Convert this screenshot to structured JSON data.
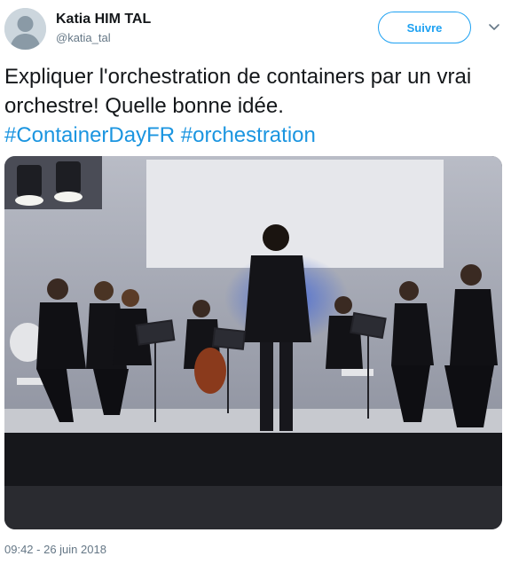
{
  "user": {
    "name": "Katia HIM TAL",
    "handle": "@katia_tal",
    "avatar_icon": "default-avatar-icon"
  },
  "follow_button": {
    "label": "Suivre"
  },
  "menu_icon": "chevron-down-icon",
  "tweet": {
    "text_line": "Expliquer l'orchestration de containers par un vrai orchestre! Quelle bonne idée.",
    "hashtags": [
      "#ContainerDayFR",
      "#orchestration"
    ]
  },
  "media": {
    "type": "photo"
  },
  "timestamp": "09:42 - 26 juin 2018",
  "colors": {
    "accent": "#1da1f2",
    "hashtag": "#1b95e0",
    "secondary_text": "#657786",
    "primary_text": "#14171a"
  }
}
